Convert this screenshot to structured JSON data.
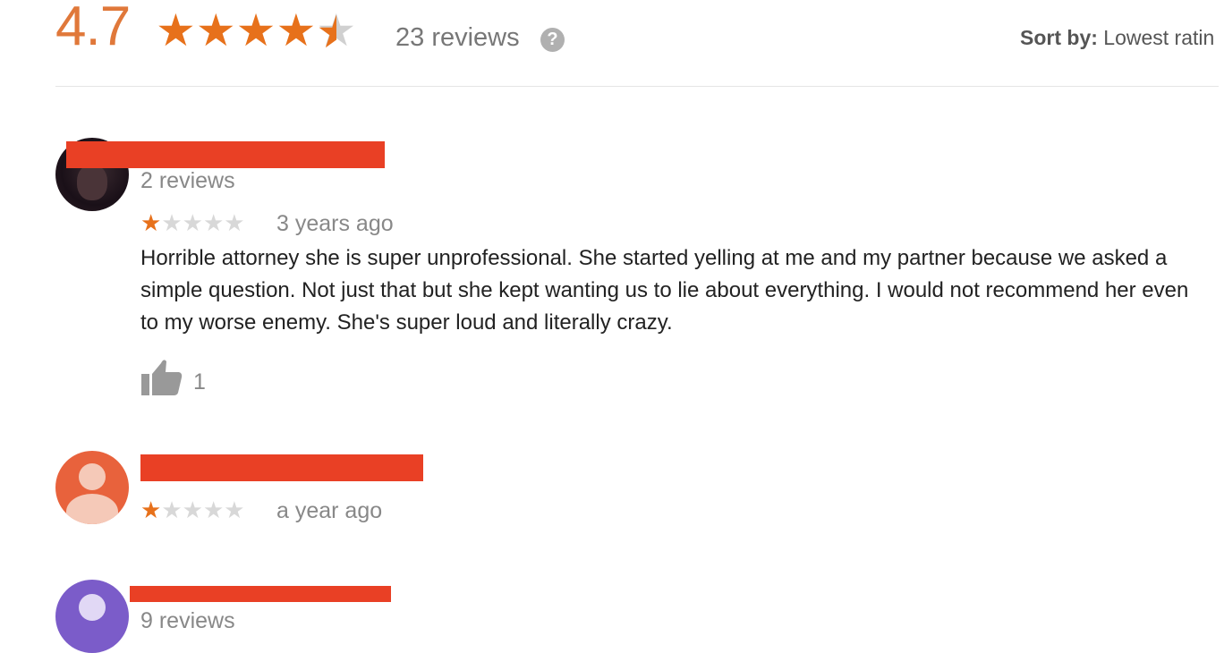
{
  "summary": {
    "rating": "4.7",
    "stars": 4.7,
    "review_count": "23 reviews",
    "help_icon": "?",
    "sort_label": "Sort by:",
    "sort_value": "Lowest ratin"
  },
  "reviews": [
    {
      "reviewer_reviews": "2 reviews",
      "stars": 1,
      "when": "3 years ago",
      "text": "Horrible attorney she is super unprofessional. She started yelling at me and my partner because we asked a simple question. Not just that but she kept wanting us to lie about everything. I would not recommend her even to my worse enemy. She's super loud and literally crazy.",
      "likes": "1"
    },
    {
      "stars": 1,
      "when": "a year ago"
    },
    {
      "reviewer_reviews": "9 reviews"
    }
  ],
  "colors": {
    "accent_orange": "#e7711b",
    "redaction": "#e94025",
    "muted_text": "#888888"
  },
  "icons": {
    "thumbs_up": "thumbs-up-icon",
    "help": "help-icon",
    "star": "star-icon"
  }
}
